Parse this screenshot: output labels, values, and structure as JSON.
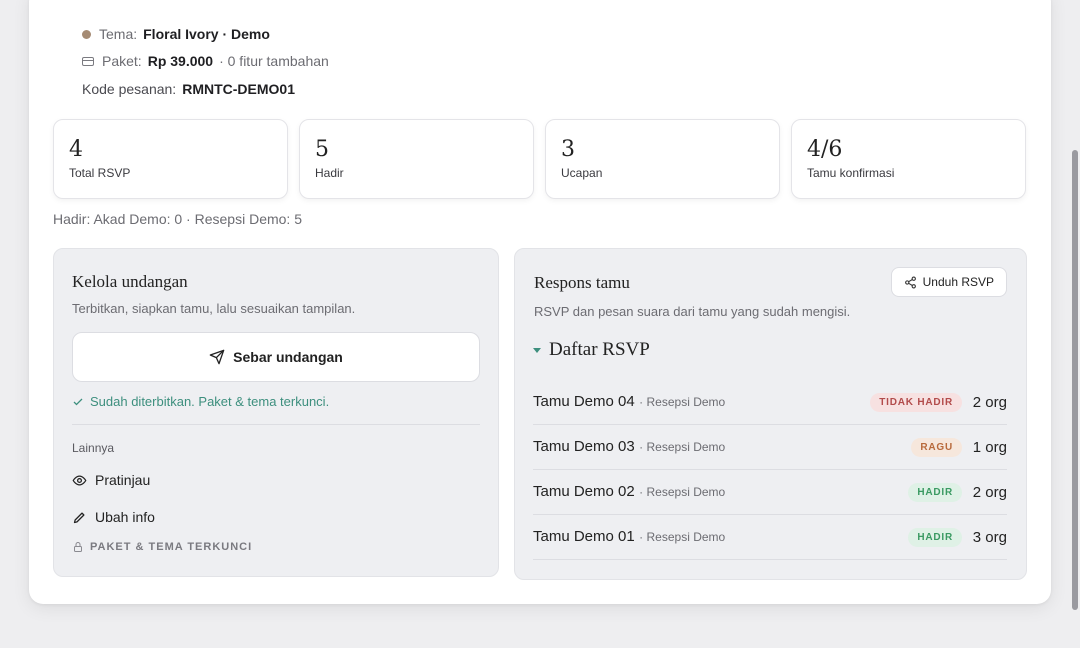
{
  "summary": {
    "theme_label": "Tema:",
    "theme_value": "Floral Ivory · Demo",
    "package_label": "Paket:",
    "package_value": "Rp 39.000",
    "package_extra": "· 0 fitur tambahan",
    "order_label": "Kode pesanan:",
    "order_value": "RMNTC-DEMO01"
  },
  "stats": [
    {
      "value": "4",
      "label": "Total RSVP"
    },
    {
      "value": "5",
      "label": "Hadir"
    },
    {
      "value": "3",
      "label": "Ucapan"
    },
    {
      "value": "4/6",
      "label": "Tamu konfirmasi"
    }
  ],
  "attendance_line": "Hadir: Akad Demo: 0 · Resepsi Demo: 5",
  "manage": {
    "title": "Kelola undangan",
    "subtitle": "Terbitkan, siapkan tamu, lalu sesuaikan tampilan.",
    "send_button": "Sebar undangan",
    "published_status": "Sudah diterbitkan. Paket & tema terkunci.",
    "other_label": "Lainnya",
    "preview_link": "Pratinjau",
    "edit_link": "Ubah info",
    "locked_label": "PAKET & TEMA TERKUNCI"
  },
  "responses": {
    "title": "Respons tamu",
    "subtitle": "RSVP dan pesan suara dari tamu yang sudah mengisi.",
    "download_button": "Unduh RSVP",
    "list_title": "Daftar RSVP",
    "rows": [
      {
        "name": "Tamu Demo 04",
        "event": "· Resepsi Demo",
        "status": "TIDAK HADIR",
        "count": "2 org"
      },
      {
        "name": "Tamu Demo 03",
        "event": "· Resepsi Demo",
        "status": "RAGU",
        "count": "1 org"
      },
      {
        "name": "Tamu Demo 02",
        "event": "· Resepsi Demo",
        "status": "HADIR",
        "count": "2 org"
      },
      {
        "name": "Tamu Demo 01",
        "event": "· Resepsi Demo",
        "status": "HADIR",
        "count": "3 org"
      }
    ]
  },
  "colors": {
    "accent": "#3d8f7e",
    "theme_dot": "#a58b74",
    "badge_absent": "#b24b4b",
    "badge_maybe": "#b86a3c",
    "badge_present": "#3a9a62"
  }
}
